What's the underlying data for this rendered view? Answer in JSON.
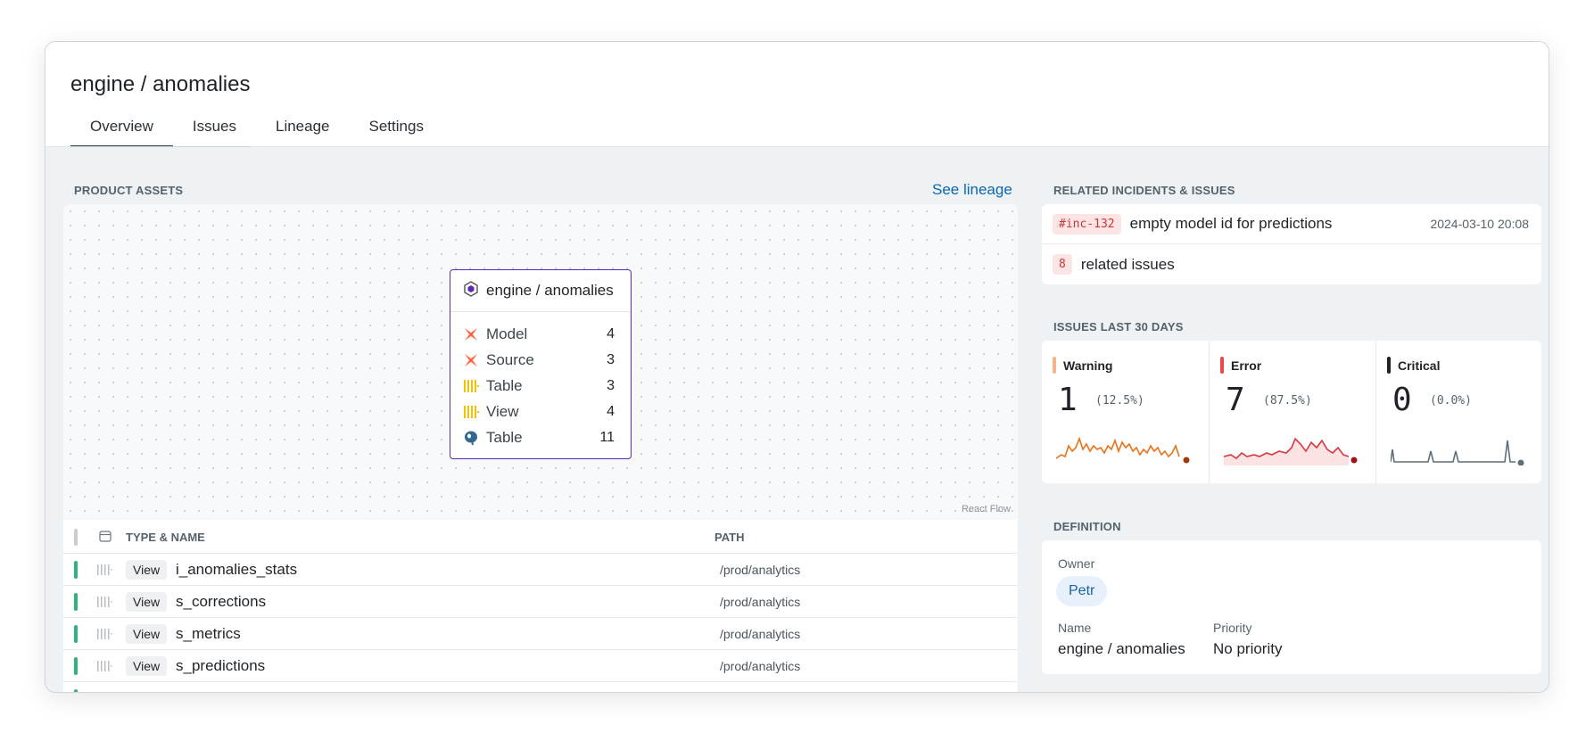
{
  "page": {
    "title": "engine / anomalies"
  },
  "tabs": [
    {
      "label": "Overview",
      "active": true
    },
    {
      "label": "Issues"
    },
    {
      "label": "Lineage"
    },
    {
      "label": "Settings"
    }
  ],
  "assets": {
    "section_title": "PRODUCT ASSETS",
    "see_lineage": "See lineage",
    "attribution": "React Flow",
    "node": {
      "title": "engine / anomalies",
      "rows": [
        {
          "icon": "dbt-icon",
          "label": "Model",
          "count": "4"
        },
        {
          "icon": "dbt-icon",
          "label": "Source",
          "count": "3"
        },
        {
          "icon": "snowflake-bars-icon",
          "label": "Table",
          "count": "3"
        },
        {
          "icon": "snowflake-bars-icon",
          "label": "View",
          "count": "4"
        },
        {
          "icon": "postgres-icon",
          "label": "Table",
          "count": "11"
        }
      ]
    },
    "table": {
      "headers": {
        "type_name": "TYPE & NAME",
        "path": "PATH"
      },
      "rows": [
        {
          "type": "View",
          "name": "i_anomalies_stats",
          "path": "/prod/analytics"
        },
        {
          "type": "View",
          "name": "s_corrections",
          "path": "/prod/analytics"
        },
        {
          "type": "View",
          "name": "s_metrics",
          "path": "/prod/analytics"
        },
        {
          "type": "View",
          "name": "s_predictions",
          "path": "/prod/analytics"
        }
      ]
    }
  },
  "incidents": {
    "section_title": "RELATED INCIDENTS & ISSUES",
    "incident": {
      "code": "#inc-132",
      "text": "empty model id for predictions",
      "date": "2024-03-10 20:08"
    },
    "related": {
      "count": "8",
      "text": "related issues"
    }
  },
  "issues": {
    "section_title": "ISSUES LAST 30 DAYS",
    "stats": [
      {
        "label": "Warning",
        "value": "1",
        "pct": "(12.5%)",
        "color": "#f5b48a",
        "line_color": "#e8731b",
        "dot_color": "#a33a0a"
      },
      {
        "label": "Error",
        "value": "7",
        "pct": "(87.5%)",
        "color": "#e5484d",
        "line_color": "#d9363e",
        "dot_color": "#a11219"
      },
      {
        "label": "Critical",
        "value": "0",
        "pct": "(0.0%)",
        "color": "#1f2328",
        "line_color": "#5f6f7a",
        "dot_color": "#5f6f7a"
      }
    ]
  },
  "definition": {
    "section_title": "DEFINITION",
    "owner_label": "Owner",
    "owner": "Petr",
    "name_label": "Name",
    "name": "engine / anomalies",
    "priority_label": "Priority",
    "priority": "No priority"
  }
}
